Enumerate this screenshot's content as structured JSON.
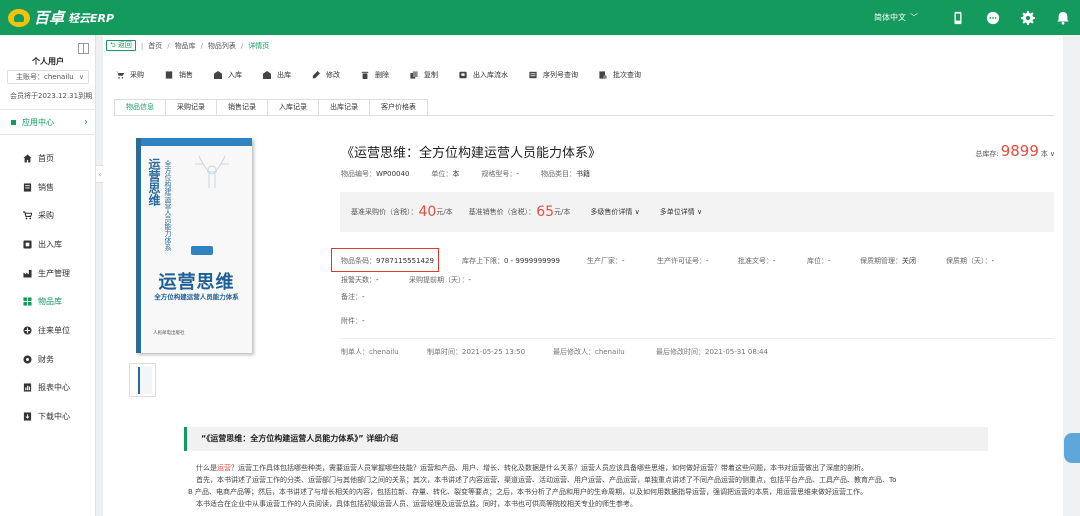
{
  "app": {
    "logo_main": "百卓",
    "logo_sub": "轻云ERP"
  },
  "topbar": {
    "language": "简体中文",
    "icons": [
      "mobile-icon",
      "chat-icon",
      "gear-icon",
      "bell-icon"
    ]
  },
  "sidebar": {
    "user_name": "个人用户",
    "account_label": "主账号：chenailu",
    "expire_text": "会员将于2023.12.31到期",
    "app_center": "应用中心",
    "items": [
      {
        "label": "首页",
        "icon": "home-icon"
      },
      {
        "label": "销售",
        "icon": "sales-icon"
      },
      {
        "label": "采购",
        "icon": "cart-icon"
      },
      {
        "label": "出入库",
        "icon": "warehouse-icon"
      },
      {
        "label": "生产管理",
        "icon": "production-icon"
      },
      {
        "label": "物品库",
        "icon": "goods-icon",
        "active": true
      },
      {
        "label": "往来单位",
        "icon": "partner-icon"
      },
      {
        "label": "财务",
        "icon": "finance-icon"
      },
      {
        "label": "报表中心",
        "icon": "report-icon"
      },
      {
        "label": "下载中心",
        "icon": "download-icon"
      }
    ]
  },
  "breadcrumb": {
    "back": "返回",
    "items": [
      "首页",
      "物品库",
      "物品列表",
      "详情页"
    ]
  },
  "toolbar": [
    "采购",
    "销售",
    "入库",
    "出库",
    "修改",
    "删除",
    "复制",
    "出入库流水",
    "序列号查询",
    "批次查询"
  ],
  "tabs": [
    "物品信息",
    "采购记录",
    "销售记录",
    "入库记录",
    "出库记录",
    "客户价格表"
  ],
  "product": {
    "title": "《运营思维：全方位构建运营人员能力体系》",
    "stock_label": "总库存:",
    "stock_value": "9899",
    "stock_unit": "本",
    "code_label": "物品编号：",
    "code": "WP00040",
    "unit_label": "单位：",
    "unit": "本",
    "spec_label": "规格型号：",
    "spec": "-",
    "category_label": "物品类目：",
    "category": "书籍",
    "purchase_price_label": "基准采购价（含税）：",
    "purchase_price": "40",
    "sale_price_label": "基准销售价（含税）：",
    "sale_price": "65",
    "price_unit": "元/本",
    "multi_level_price": "多级售价详情",
    "multi_unit": "多单位详情",
    "barcode_label": "物品条码：",
    "barcode": "9787115551429",
    "stock_limit_label": "库存上下限：",
    "stock_limit": "0 - 9999999999",
    "manufacturer_label": "生产厂家：",
    "manufacturer": "-",
    "license_label": "生产许可证号：",
    "license": "-",
    "approval_label": "批准文号：",
    "approval": "-",
    "location_label": "库位：",
    "location": "-",
    "shelf_mgmt_label": "保质期管理：",
    "shelf_mgmt": "关闭",
    "shelf_days_label": "保质期（天）：",
    "shelf_days": "-",
    "alert_days_label": "报警天数：",
    "alert_days": "-",
    "purchase_lead_label": "采购提前期（天）：",
    "purchase_lead": "-",
    "remark_label": "备注：",
    "remark": "-",
    "attachment_label": "附件：",
    "attachment": "-",
    "creator_label": "制单人：",
    "creator": "chenailu",
    "created_label": "制单时间：",
    "created": "2021-05-25 13:50",
    "modifier_label": "最后修改人：",
    "modifier": "chenailu",
    "modified_label": "最后修改时间：",
    "modified": "2021-05-31 08:44"
  },
  "book_cover": {
    "vertical_title": "运营思维",
    "vertical_sub": "全方位构建运营人员能力体系",
    "big_title": "运营思维",
    "subtitle": "全方位构建运营人员能力体系",
    "brand": "PMTalk",
    "publisher": "人民邮电出版社"
  },
  "intro": {
    "heading": "“《运营思维：全方位构建运营人员能力体系》” 详细介绍",
    "p1_pre": "什么是",
    "p1_red": "运营",
    "p1_post": "？运营工作具体包括哪些种类，需要运营人员掌握哪些技能？运营和产品、用户、增长、转化及数据是什么关系？运营人员应该具备哪些思维，如何做好运营？带着这些问题，本书对运营做出了深度的剖析。",
    "p2": "首先，本书讲述了运营工作的分类、运营部门与其他部门之间的关系；其次，本书讲述了内容运营、渠道运营、活动运营、用户运营、产品运营，单独重点讲述了不同产品运营的侧重点，包括平台产品、工具产品、教育产品、To",
    "p3": "B 产品、电商产品等；然后，本书讲述了与增长相关的内容，包括拉新、存量、转化、裂变等要点；之后，本书分析了产品和用户的生命周期，以及如何用数据指导运营，强调把运营的本质，用运营思维来做好运营工作。",
    "p4": "本书适合在企业中从事运营工作的人员阅读，具体包括初级运营人员、运营经理及运营总监。同时，本书也可供高等院校相关专业的师生参考。"
  }
}
